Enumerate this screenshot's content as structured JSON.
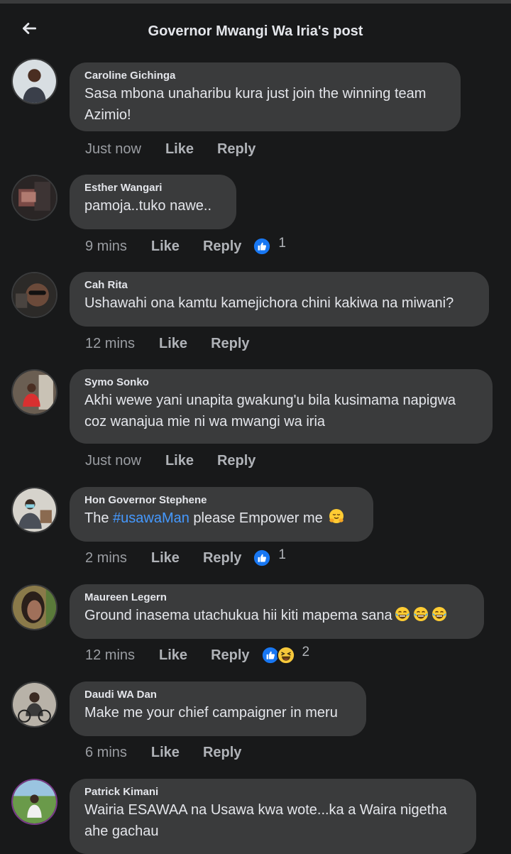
{
  "header": {
    "title": "Governor Mwangi Wa Iria's post"
  },
  "comments": [
    {
      "author": "Caroline Gichinga",
      "line1": "Sasa mbona unaharibu kura just join the winning team",
      "line2": "Azimio!",
      "time": "Just now",
      "like": "Like",
      "reply": "Reply"
    },
    {
      "author": "Esther Wangari",
      "line1": "pamoja..tuko nawe..",
      "time": "9 mins",
      "like": "Like",
      "reply": "Reply",
      "reaction_count": "1"
    },
    {
      "author": "Cah Rita",
      "line1": "Ushawahi ona kamtu kamejichora chini kakiwa na miwani?",
      "time": "12 mins",
      "like": "Like",
      "reply": "Reply"
    },
    {
      "author": "Symo Sonko",
      "line1": "Akhi wewe yani unapita gwakung'u bila kusimama napigwa",
      "line2": "coz wanajua mie ni wa mwangi wa iria",
      "time": "Just now",
      "like": "Like",
      "reply": "Reply"
    },
    {
      "author": "Hon Governor Stephene",
      "prefix": "The ",
      "hashtag": "#usawaMan",
      "suffix": " please Empower me",
      "time": "2 mins",
      "like": "Like",
      "reply": "Reply",
      "reaction_count": "1"
    },
    {
      "author": "Maureen Legern",
      "line1": "Ground inasema utachukua hii kiti mapema sana",
      "time": "12 mins",
      "like": "Like",
      "reply": "Reply",
      "reaction_count": "2"
    },
    {
      "author": "Daudi WA Dan",
      "line1": "Make me your chief campaigner in meru",
      "time": "6 mins",
      "like": "Like",
      "reply": "Reply"
    },
    {
      "author": "Patrick Kimani",
      "line1": "Wairia ESAWAA na Usawa kwa wote...ka a Waira nigetha",
      "line2": "ahe gachau"
    }
  ],
  "icons": {
    "back": "arrow-left-icon",
    "like_reaction": "thumbs-up-icon",
    "haha_reaction": "laughing-face-icon",
    "tears_emoji": "tears-of-joy-emoji",
    "hug_emoji": "hugging-face-emoji"
  },
  "colors": {
    "background": "#18191a",
    "bubble": "#3a3b3c",
    "hashtag": "#4599ff",
    "like_blue": "#1877f2"
  }
}
